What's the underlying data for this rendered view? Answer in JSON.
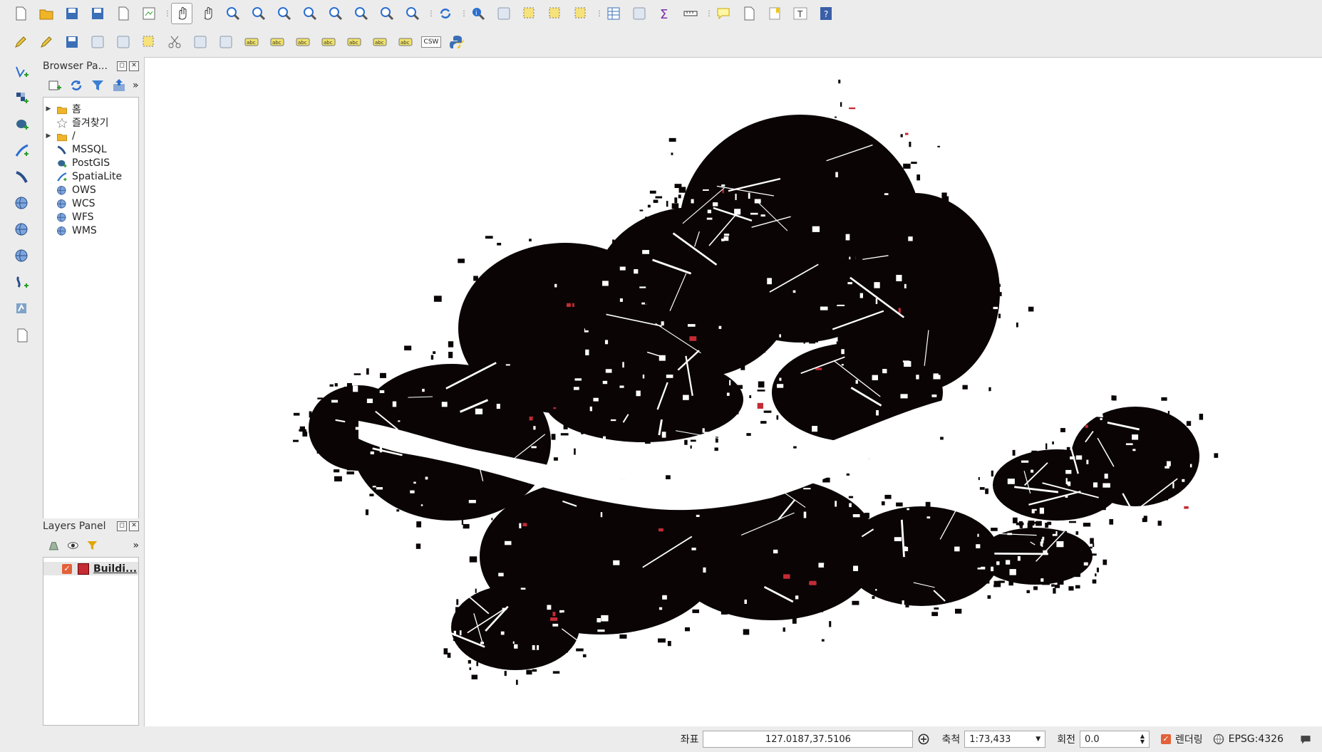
{
  "colors": {
    "accent": "#e2613a",
    "layer_fill": "#c42b34",
    "buildings": "#0a0405"
  },
  "toolbar_top": [
    "new-project-icon",
    "open-project-icon",
    "save-project-icon",
    "save-as-icon",
    "new-print-layout-icon",
    "layout-manager-icon",
    "pan-map-icon",
    "pan-to-selection-icon",
    "zoom-in-icon",
    "zoom-out-icon",
    "zoom-native-icon",
    "zoom-full-icon",
    "zoom-to-selection-icon",
    "zoom-to-layer-icon",
    "zoom-last-icon",
    "zoom-next-icon",
    "refresh-icon",
    "identify-icon",
    "action-icon",
    "select-features-icon",
    "select-expression-icon",
    "deselect-icon",
    "attribute-table-icon",
    "field-calculator-icon",
    "statistics-icon",
    "measure-icon",
    "map-tips-icon",
    "new-bookmark-icon",
    "show-bookmarks-icon",
    "text-annotation-icon",
    "help-icon"
  ],
  "toolbar_edit": [
    "digitize-icon",
    "toggle-editing-icon",
    "save-edits-icon",
    "add-feature-icon",
    "vertex-tool-icon",
    "delete-selected-icon",
    "cut-features-icon",
    "copy-features-icon",
    "paste-features-icon",
    "label-abc-icon",
    "layer-labeling-icon",
    "pin-labels-icon",
    "show-hide-labels-icon",
    "move-label-icon",
    "rotate-label-icon",
    "change-label-icon",
    "csw-icon",
    "python-console-icon"
  ],
  "csw_label": "CSW",
  "side_tools": [
    "add-vector-layer-icon",
    "add-raster-layer-icon",
    "add-postgis-layer-icon",
    "add-spatialite-layer-icon",
    "add-mssql-layer-icon",
    "add-wms-layer-icon",
    "add-wcs-layer-icon",
    "add-wfs-layer-icon",
    "add-delimited-text-icon",
    "add-virtual-layer-icon",
    "new-layer-icon"
  ],
  "browser": {
    "title": "Browser Pa...",
    "items": [
      {
        "label": "홈",
        "icon": "folder-icon",
        "expandable": true
      },
      {
        "label": "즐겨찾기",
        "icon": "star-icon",
        "expandable": false
      },
      {
        "label": "/",
        "icon": "folder-icon",
        "expandable": true
      },
      {
        "label": "MSSQL",
        "icon": "mssql-icon",
        "expandable": false
      },
      {
        "label": "PostGIS",
        "icon": "postgis-icon",
        "expandable": false
      },
      {
        "label": "SpatiaLite",
        "icon": "spatialite-icon",
        "expandable": false
      },
      {
        "label": "OWS",
        "icon": "ows-icon",
        "expandable": false
      },
      {
        "label": "WCS",
        "icon": "wcs-icon",
        "expandable": false
      },
      {
        "label": "WFS",
        "icon": "wfs-icon",
        "expandable": false
      },
      {
        "label": "WMS",
        "icon": "wms-icon",
        "expandable": false
      }
    ]
  },
  "layers": {
    "title": "Layers Panel",
    "items": [
      {
        "label": "Buildi...",
        "checked": true
      }
    ]
  },
  "status": {
    "coord_label": "좌표",
    "coord_value": "127.0187,37.5106",
    "scale_label": "축척",
    "scale_value": "1:73,433",
    "rotation_label": "회전",
    "rotation_value": "0.0",
    "render_label": "렌더링",
    "crs_label": "EPSG:4326"
  }
}
